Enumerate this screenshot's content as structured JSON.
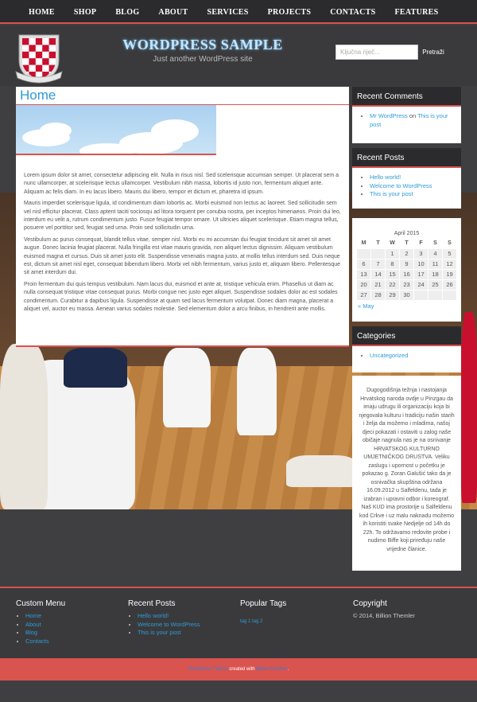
{
  "nav": [
    "HOME",
    "SHOP",
    "BLOG",
    "ABOUT",
    "SERVICES",
    "PROJECTS",
    "CONTACTS",
    "FEATURES"
  ],
  "header": {
    "title": "WORDPRESS SAMPLE",
    "tagline": "Just another WordPress site"
  },
  "search": {
    "placeholder": "Ključna riječ...",
    "button": "Pretraži"
  },
  "page": {
    "title": "Home",
    "paragraphs": [
      "Lorem ipsum dolor sit amet, consectetur adipiscing elit. Nulla in risus nisl. Sed scelerisque accumsan semper. Ut placerat sem a nunc ullamcorper, at scelerisque lectus ullamcorper. Vestibulum nibh massa, lobortis id justo non, fermentum aliquet ante. Aliquam ac felis diam. In eu lacus libero. Mauris dui libero, tempor et dictum et, pharetra id ipsum.",
      "Mauris imperdiet scelerisque ligula, id condimentum diam lobortis ac. Morbi euismod non lectus ac laoreet. Sed sollicitudin sem vel nisl efficitur placerat. Class aptent taciti sociosqu ad litora torquent per conubia nostra, per inceptos himenaeos. Proin dui leo, interdum eu velit a, rutrum condimentum justo. Fusce feugiat tempor ornare. Ut ultricies aliquet scelerisque. Etiam magna tellus, posuere vel porttitor sed, feugiat sed urna. Proin sed sollicitudin urna.",
      "Vestibulum ac purus consequat, blandit tellus vitae, semper nisl. Morbi eu mi accumsan dui feugiat tincidunt sit amet sit amet augue. Donec lacinia feugiat placerat. Nulla fringilla est vitae mauris gravida, non aliquet lectus dignissim. Aliquam vestibulum euismod magna et cursus. Duis sit amet justo elit. Suspendisse venenatis magna justo, at mollis tellus interdum sed. Duis neque est, dictum sit amet nisl eget, consequat bibendum libero. Morbi vel nibh fermentum, varius justo et, aliquam libero. Pellentesque sit amet interdum dui.",
      "Proin fermentum dui quis tempus vestibulum. Nam lacus dui, euismod et ante at, tristique vehicula enim. Phasellus ut diam ac nulla consequat tristique vitae consequat purus. Morbi congue nec justo eget aliquet. Suspendisse sodales dolor ac est sodales condimentum. Curabitur a dapibus ligula. Suspendisse at quam sed lacus fermentum volutpat. Donec diam magna, placerat a aliquet vel, auctor eu massa. Aenean varius sodales molestie. Sed elementum dolor a arcu finibus, in hendrerit ante mollis."
    ]
  },
  "sidebar": {
    "recent_comments": {
      "title": "Recent Comments",
      "author": "Mr WordPress",
      "on": " on ",
      "post": "This is your post"
    },
    "recent_posts": {
      "title": "Recent Posts",
      "items": [
        "Hello world!",
        "Welcome to WordPress",
        "This is your post"
      ]
    },
    "calendar": {
      "caption": "April 2015",
      "days": [
        "M",
        "T",
        "W",
        "T",
        "F",
        "S",
        "S"
      ],
      "rows": [
        [
          "",
          "",
          "1",
          "2",
          "3",
          "4",
          "5"
        ],
        [
          "6",
          "7",
          "8",
          "9",
          "10",
          "11",
          "12"
        ],
        [
          "13",
          "14",
          "15",
          "16",
          "17",
          "18",
          "19"
        ],
        [
          "20",
          "21",
          "22",
          "23",
          "24",
          "25",
          "26"
        ],
        [
          "27",
          "28",
          "29",
          "30",
          "",
          "",
          ""
        ]
      ],
      "prev": "« May"
    },
    "categories": {
      "title": "Categories",
      "items": [
        "Uncategorized"
      ]
    },
    "about": "Dugogodišnja težnja i nastojanja Hrvatskog naroda ovdje u Pinzgau da imaju udrugu ili organizaciju koja bi njegovala kulturu i tradiciju našin starih i želja da možemo i mladima, našoj djeci pokazati i ostaviti u zalog naše običaje nagnula nas je na osnivanje HRVATSKOG KULTURNO UMJETNIČKOG DRUSTVA. Veliku zaslugu i upornost u početku je pokazao g. Zoran Galušić tako da je osnivačka skupština održana 16.09.2012 u Salfeldenu, tada je izabran i upravni odbor i koreograf. Naš KUD ima prostorije u Salfeldenu kod Crkve i uz malu naknadu možemo ih koristiti svake Nedjelje od 14h do 22h. To održavamo redovite probe i nudimo Biffe koji priređuju naše vrijedne članice."
  },
  "footer": {
    "menu": {
      "title": "Custom Menu",
      "items": [
        "Home",
        "About",
        "Blog",
        "Contacts"
      ]
    },
    "posts": {
      "title": "Recent Posts",
      "items": [
        "Hello world!",
        "Welcome to WordPress",
        "This is your post"
      ]
    },
    "tags": {
      "title": "Popular Tags",
      "items": "tag 1 tag 2"
    },
    "copyright": {
      "title": "Copyright",
      "text": "© 2014, Billion Themler"
    }
  },
  "bottom": {
    "link1": "WordPress Theme",
    "mid": " created with ",
    "link2": "Billion Themler",
    "end": "."
  },
  "colors": {
    "accent": "#d9534f",
    "link": "#2f9bd7",
    "dark": "#2b2b2d"
  }
}
